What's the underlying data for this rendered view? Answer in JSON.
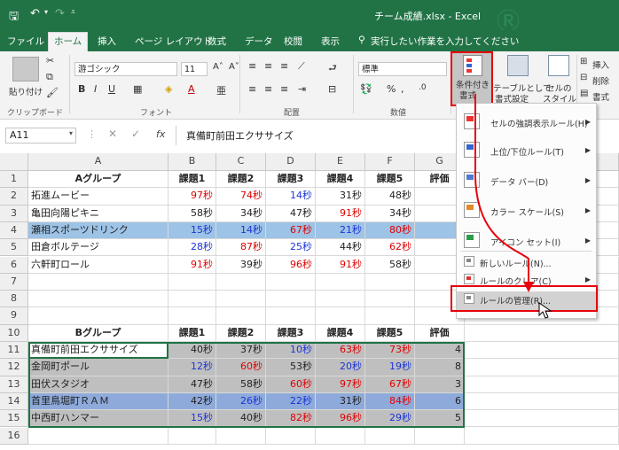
{
  "window": {
    "title": "チーム成績.xlsx - Excel"
  },
  "tabs": [
    "ファイル",
    "ホーム",
    "挿入",
    "ページ レイアウト",
    "数式",
    "データ",
    "校閲",
    "表示"
  ],
  "tell_me": "実行したい作業を入力してください",
  "ribbon": {
    "paste": "貼り付け",
    "font_name": "游ゴシック",
    "font_size": "11",
    "number_format": "標準",
    "groups": [
      "クリップボード",
      "フォント",
      "配置",
      "数値"
    ],
    "conditional_format": [
      "条件付き",
      "書式"
    ],
    "format_as_table": [
      "テーブルとして",
      "書式設定"
    ],
    "cell_styles": [
      "セルの",
      "スタイル"
    ],
    "insert": "挿入",
    "delete": "削除",
    "format": "書式"
  },
  "formula_bar": {
    "name_box": "A11",
    "fx": "fx",
    "value": "真備町前田エクササイズ"
  },
  "columns": [
    "A",
    "B",
    "C",
    "D",
    "E",
    "F",
    "G"
  ],
  "rows": [
    "1",
    "2",
    "3",
    "4",
    "5",
    "6",
    "7",
    "8",
    "9",
    "10",
    "11",
    "12",
    "13",
    "14",
    "15",
    "16"
  ],
  "table_a": {
    "header": [
      "Aグループ",
      "課題1",
      "課題2",
      "課題3",
      "課題4",
      "課題5",
      "評価"
    ],
    "data": [
      [
        "拓進ムービー",
        "97秒",
        "74秒",
        "14秒",
        "31秒",
        "48秒"
      ],
      [
        "亀田向陽ピキニ",
        "58秒",
        "34秒",
        "47秒",
        "91秒",
        "34秒"
      ],
      [
        "瀬相スポーツドリンク",
        "15秒",
        "14秒",
        "67秒",
        "21秒",
        "80秒"
      ],
      [
        "田倉ボルテージ",
        "28秒",
        "87秒",
        "25秒",
        "44秒",
        "62秒"
      ],
      [
        "六軒町ロール",
        "91秒",
        "39秒",
        "96秒",
        "91秒",
        "58秒"
      ]
    ]
  },
  "table_b": {
    "header": [
      "Bグループ",
      "課題1",
      "課題2",
      "課題3",
      "課題4",
      "課題5",
      "評価"
    ],
    "data": [
      [
        "真備町前田エクササイズ",
        "40秒",
        "37秒",
        "10秒",
        "63秒",
        "73秒",
        "4"
      ],
      [
        "金岡町ポール",
        "12秒",
        "60秒",
        "53秒",
        "20秒",
        "19秒",
        "8"
      ],
      [
        "田伏スタジオ",
        "47秒",
        "58秒",
        "60秒",
        "97秒",
        "67秒",
        "3"
      ],
      [
        "首里鳥堀町ＲＡＭ",
        "42秒",
        "26秒",
        "22秒",
        "31秒",
        "84秒",
        "6"
      ],
      [
        "中西町ハンマー",
        "15秒",
        "40秒",
        "82秒",
        "96秒",
        "29秒",
        "5"
      ]
    ]
  },
  "menu": {
    "items": [
      {
        "label": "セルの強調表示ルール(H)",
        "icon": "highlight-rules-icon",
        "submenu": true
      },
      {
        "label": "上位/下位ルール(T)",
        "icon": "top-bottom-rules-icon",
        "submenu": true
      },
      {
        "label": "データ バー(D)",
        "icon": "data-bars-icon",
        "submenu": true
      },
      {
        "label": "カラー スケール(S)",
        "icon": "color-scales-icon",
        "submenu": true
      },
      {
        "label": "アイコン セット(I)",
        "icon": "icon-sets-icon",
        "submenu": true
      },
      {
        "label": "新しいルール(N)...",
        "icon": "new-rule-icon",
        "submenu": false
      },
      {
        "label": "ルールのクリア(C)",
        "icon": "clear-rules-icon",
        "submenu": true
      },
      {
        "label": "ルールの管理(R)...",
        "icon": "manage-rules-icon",
        "submenu": false
      }
    ]
  },
  "colors": {
    "excel_green": "#217346",
    "highlight_red": "#e00000",
    "highlight_blue": "#1a34d8",
    "blue_fill": "#9dc3e6",
    "gray_fill": "#bfbfbf",
    "dark_blue_fill": "#8eaadb",
    "annotation": "#e8000b"
  }
}
